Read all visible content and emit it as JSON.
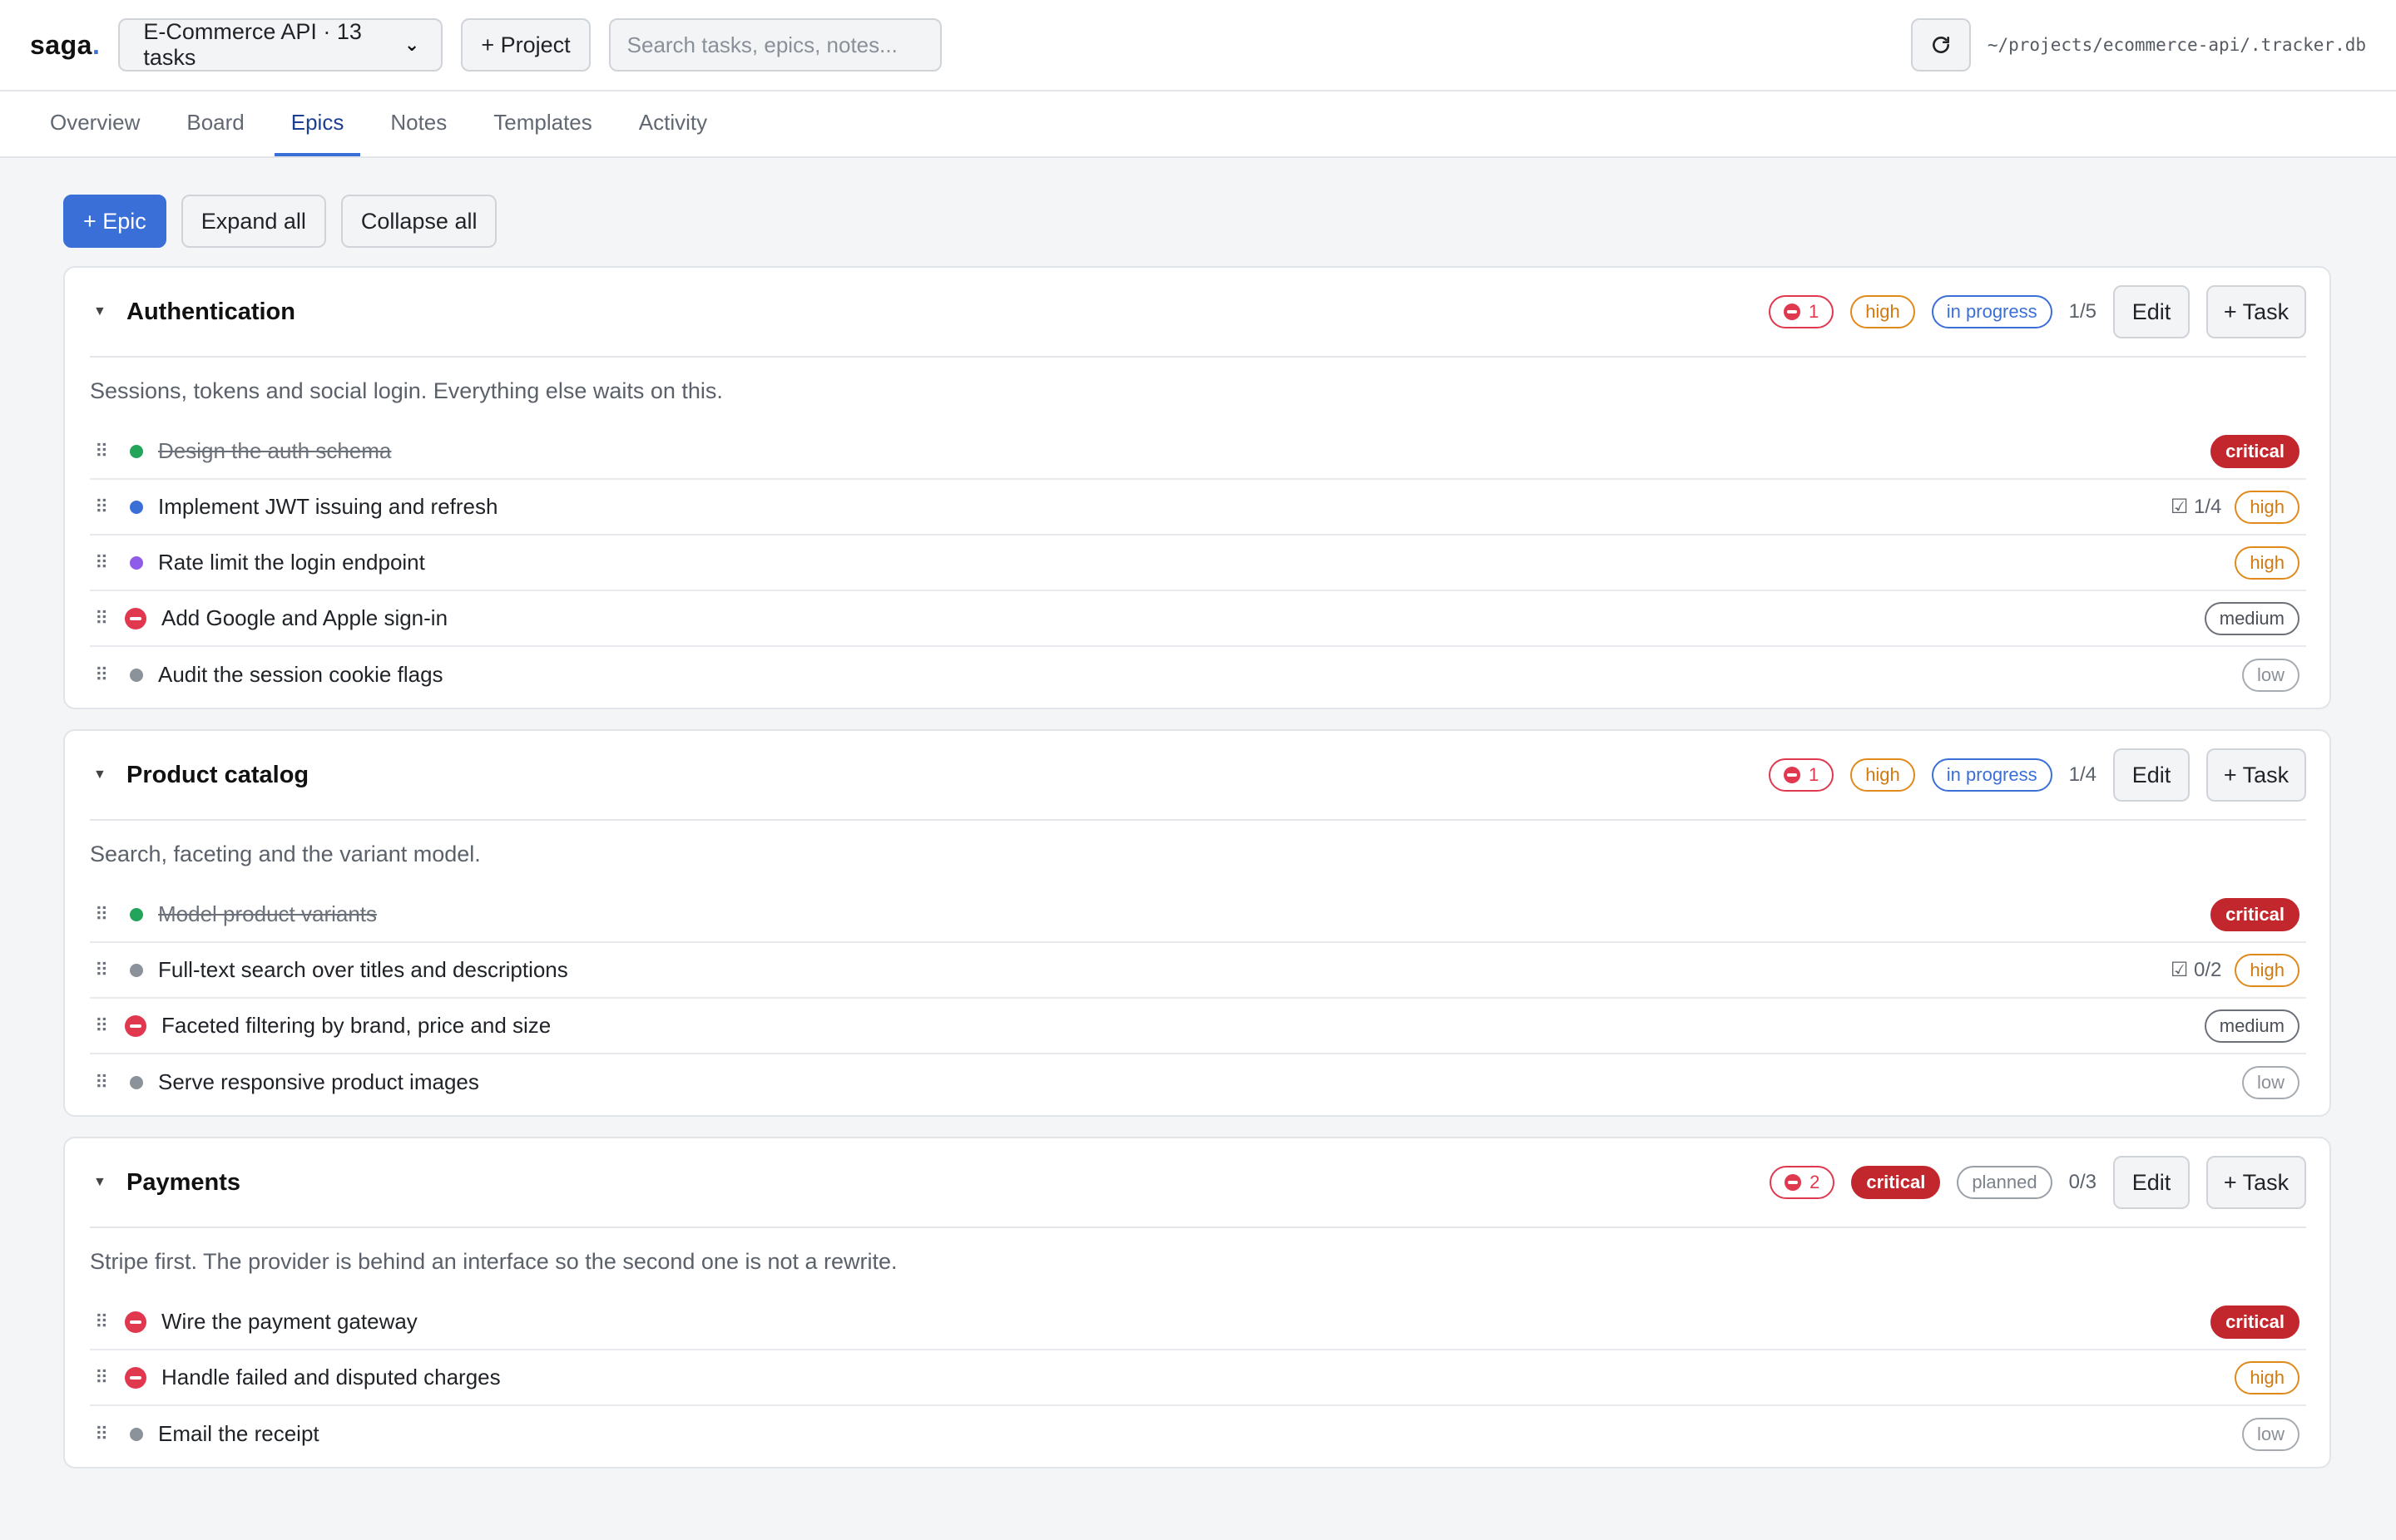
{
  "app": {
    "brand": "saga",
    "brand_dot": "."
  },
  "header": {
    "project_select": "E-Commerce API · 13 tasks",
    "add_project": "+ Project",
    "search_placeholder": "Search tasks, epics, notes...",
    "refresh_icon": "refresh-icon",
    "db_path": "~/projects/ecommerce-api/.tracker.db"
  },
  "tabs": [
    {
      "label": "Overview",
      "active": false
    },
    {
      "label": "Board",
      "active": false
    },
    {
      "label": "Epics",
      "active": true
    },
    {
      "label": "Notes",
      "active": false
    },
    {
      "label": "Templates",
      "active": false
    },
    {
      "label": "Activity",
      "active": false
    }
  ],
  "toolbar": {
    "add_epic": "+ Epic",
    "expand_all": "Expand all",
    "collapse_all": "Collapse all"
  },
  "colors": {
    "accent": "#3b6fd8",
    "critical": "#c1272d",
    "high": "#e08a1c",
    "blocked": "#e0394f",
    "done": "#22a55a",
    "review": "#8e5ce8"
  },
  "epics": [
    {
      "title": "Authentication",
      "blocked_count": "1",
      "priority": "high",
      "status": "in progress",
      "progress": "1/5",
      "edit": "Edit",
      "add_task": "+ Task",
      "description": "Sessions, tokens and social login. Everything else waits on this.",
      "tasks": [
        {
          "title": "Design the auth schema",
          "state": "done",
          "priority": "critical",
          "subtasks": ""
        },
        {
          "title": "Implement JWT issuing and refresh",
          "state": "progress",
          "priority": "high",
          "subtasks": "☑ 1/4"
        },
        {
          "title": "Rate limit the login endpoint",
          "state": "review",
          "priority": "high",
          "subtasks": ""
        },
        {
          "title": "Add Google and Apple sign-in",
          "state": "blocked",
          "priority": "medium",
          "subtasks": ""
        },
        {
          "title": "Audit the session cookie flags",
          "state": "todo",
          "priority": "low",
          "subtasks": ""
        }
      ]
    },
    {
      "title": "Product catalog",
      "blocked_count": "1",
      "priority": "high",
      "status": "in progress",
      "progress": "1/4",
      "edit": "Edit",
      "add_task": "+ Task",
      "description": "Search, faceting and the variant model.",
      "tasks": [
        {
          "title": "Model product variants",
          "state": "done",
          "priority": "critical",
          "subtasks": ""
        },
        {
          "title": "Full-text search over titles and descriptions",
          "state": "todo",
          "priority": "high",
          "subtasks": "☑ 0/2"
        },
        {
          "title": "Faceted filtering by brand, price and size",
          "state": "blocked",
          "priority": "medium",
          "subtasks": ""
        },
        {
          "title": "Serve responsive product images",
          "state": "todo",
          "priority": "low",
          "subtasks": ""
        }
      ]
    },
    {
      "title": "Payments",
      "blocked_count": "2",
      "priority": "critical",
      "status": "planned",
      "progress": "0/3",
      "edit": "Edit",
      "add_task": "+ Task",
      "description": "Stripe first. The provider is behind an interface so the second one is not a rewrite.",
      "tasks": [
        {
          "title": "Wire the payment gateway",
          "state": "blocked",
          "priority": "critical",
          "subtasks": ""
        },
        {
          "title": "Handle failed and disputed charges",
          "state": "blocked",
          "priority": "high",
          "subtasks": ""
        },
        {
          "title": "Email the receipt",
          "state": "todo",
          "priority": "low",
          "subtasks": ""
        }
      ]
    }
  ]
}
